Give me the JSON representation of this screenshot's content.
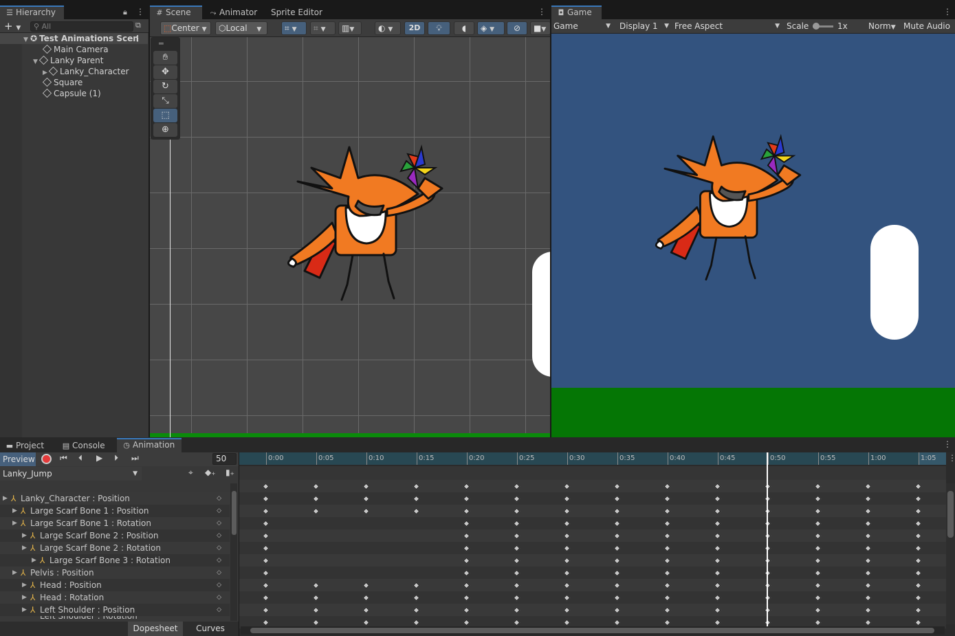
{
  "hierarchy": {
    "tab_label": "Hierarchy",
    "search_placeholder": "All",
    "scene_name": "Test Animations Scen",
    "items": [
      {
        "label": "Main Camera"
      },
      {
        "label": "Lanky Parent"
      },
      {
        "label": "Lanky_Character"
      },
      {
        "label": "Square"
      },
      {
        "label": "Capsule (1)"
      }
    ]
  },
  "scene": {
    "tabs": [
      "Scene",
      "Animator",
      "Sprite Editor"
    ],
    "pivot_label": "Center",
    "space_label": "Local",
    "mode_2d": "2D"
  },
  "game": {
    "tab_label": "Game",
    "view_dropdown": "Game",
    "display": "Display 1",
    "aspect": "Free Aspect",
    "scale_label": "Scale",
    "scale_value": "1x",
    "norm_label": "Norm",
    "mute_label": "Mute Audio",
    "colors": {
      "sky": "#33537f",
      "ground": "#057605"
    }
  },
  "bottom": {
    "tabs": [
      "Project",
      "Console",
      "Animation"
    ]
  },
  "animation": {
    "preview_label": "Preview",
    "frame_value": "50",
    "clip_name": "Lanky_Jump",
    "time_labels": [
      "0:00",
      "0:05",
      "0:10",
      "0:15",
      "0:20",
      "0:25",
      "0:30",
      "0:35",
      "0:40",
      "0:45",
      "0:50",
      "0:55",
      "1:00",
      "1:05"
    ],
    "current_frame_label": "0:50",
    "properties": [
      {
        "label": "Lanky_Character : Position",
        "indent": 0
      },
      {
        "label": "Large Scarf Bone 1 : Position",
        "indent": 1
      },
      {
        "label": "Large Scarf Bone 1 : Rotation",
        "indent": 1
      },
      {
        "label": "Large Scarf Bone 2 : Position",
        "indent": 2
      },
      {
        "label": "Large Scarf Bone 2 : Rotation",
        "indent": 2
      },
      {
        "label": "Large Scarf Bone 3 : Rotation",
        "indent": 3
      },
      {
        "label": "Pelvis : Position",
        "indent": 1
      },
      {
        "label": "Head : Position",
        "indent": 2
      },
      {
        "label": "Head : Rotation",
        "indent": 2
      },
      {
        "label": "Left Shoulder : Position",
        "indent": 2
      },
      {
        "label": "Left Shoulder : Rotation",
        "indent": 2
      }
    ],
    "bottom_tabs": [
      "Dopesheet",
      "Curves"
    ]
  }
}
